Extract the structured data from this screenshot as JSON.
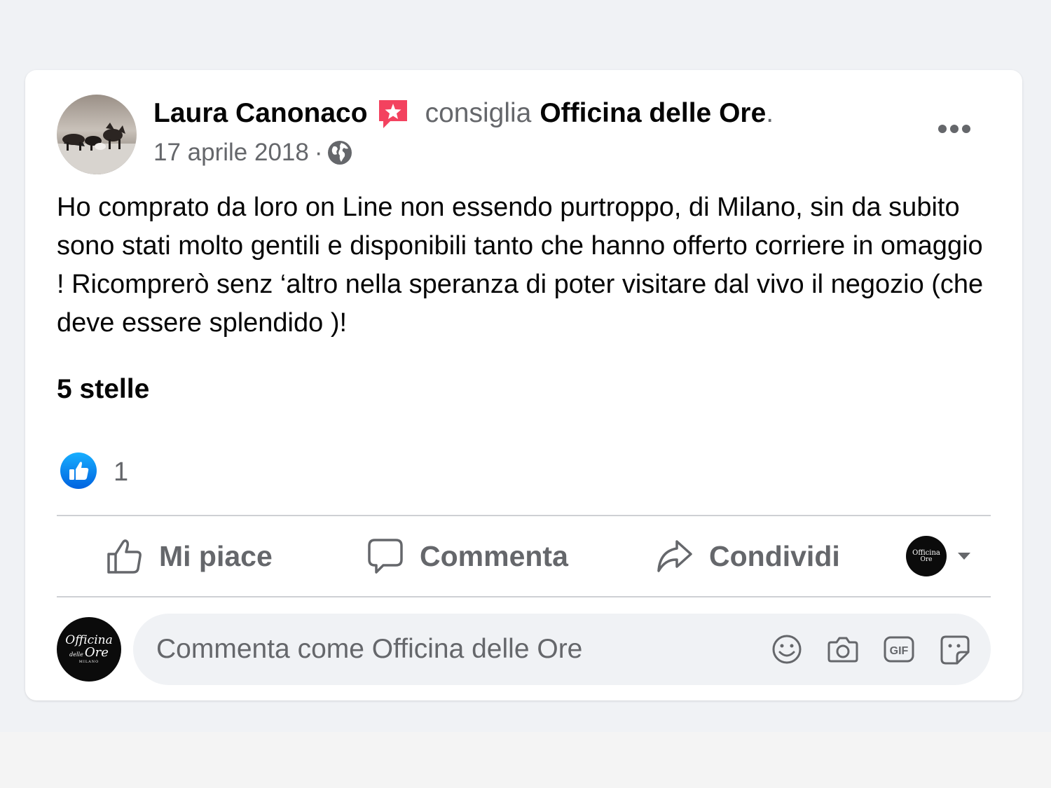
{
  "post": {
    "author": "Laura Canonaco",
    "verb": "consiglia",
    "page": "Officina delle Ore",
    "trailing_dot": ".",
    "date": "17 aprile 2018",
    "meta_separator": "·",
    "body": "Ho comprato da loro on Line non essendo  purtroppo, di Milano, sin da subito sono stati molto gentili e disponibili tanto che hanno offerto corriere in omaggio ! Ricomprerò senz ‘altro nella speranza di poter visitare dal vivo il negozio (che deve essere splendido )!",
    "rating": "5 stelle",
    "reaction_count": "1"
  },
  "actions": {
    "like": "Mi piace",
    "comment": "Commenta",
    "share": "Condividi"
  },
  "comment_box": {
    "placeholder": "Commenta come Officina delle Ore"
  },
  "logo": {
    "line1": "Officina",
    "line2": "delle",
    "line3": "Ore",
    "line4": "MILANO"
  },
  "icons": {
    "recommend": "recommend-icon",
    "privacy": "globe-icon",
    "more": "more-options-icon",
    "reaction": "like-reaction-icon",
    "like": "thumbs-up-icon",
    "comment": "speech-bubble-icon",
    "share": "share-arrow-icon",
    "emoji": "emoji-icon",
    "camera": "camera-icon",
    "gif": "gif-icon",
    "sticker": "sticker-icon"
  },
  "colors": {
    "background": "#f0f2f5",
    "card": "#ffffff",
    "primary_text": "#050505",
    "secondary_text": "#65676b",
    "like_blue": "#1877f2",
    "recommend_red": "#f3425f"
  }
}
